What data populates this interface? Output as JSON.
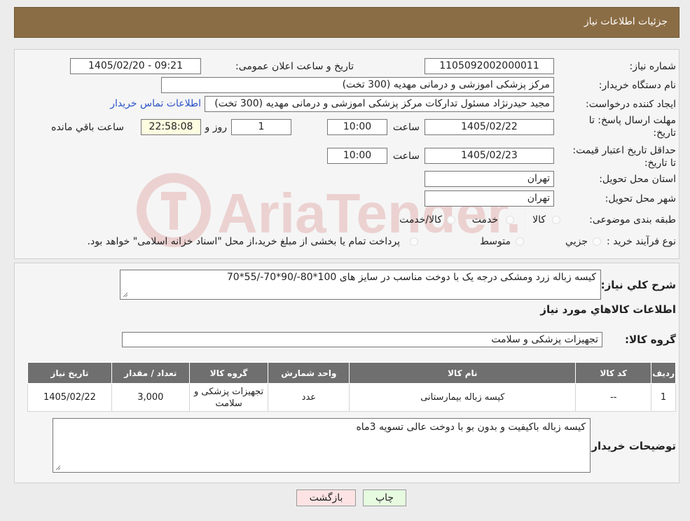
{
  "header": {
    "title": "جزئیات اطلاعات نیاز"
  },
  "info": {
    "need_number_label": "شماره نیاز:",
    "need_number": "1105092002000011",
    "announce_label": "تاریخ و ساعت اعلان عمومی:",
    "announce_value": "1405/02/20 - 09:21",
    "buyer_org_label": "نام دستگاه خریدار:",
    "buyer_org": "مرکز پزشکی  اموزشی و درمانی مهدیه (300 تخت)",
    "creator_label": "ایجاد کننده درخواست:",
    "creator": "مجید حیدرنژاد مسئول تدارکات مرکز پزشکی  اموزشی و درمانی مهدیه (300 تخت)",
    "contact_link": "اطلاعات تماس خریدار",
    "deadline_label": "مهلت ارسال پاسخ: تا تاریخ:",
    "deadline_date": "1405/02/22",
    "time_label": "ساعت",
    "deadline_time": "10:00",
    "days_value": "1",
    "days_label": "روز و",
    "remaining_time": "22:58:08",
    "remaining_label": "ساعت باقي مانده",
    "validity_label": "حداقل تاریخ اعتبار قیمت: تا تاریخ:",
    "validity_date": "1405/02/23",
    "validity_time": "10:00",
    "province_label": "استان محل تحویل:",
    "province": "تهران",
    "city_label": "شهر محل تحویل:",
    "city": "تهران",
    "category_label": "طبقه بندی موضوعی:",
    "category_options": [
      "کالا",
      "خدمت",
      "کالا/خدمت"
    ],
    "process_label": "نوع فرآیند خرید :",
    "process_options": [
      "جزیي",
      "متوسط"
    ],
    "process_note": "پرداخت تمام یا بخشی از مبلغ خرید،از محل \"اسناد خزانه اسلامی\" خواهد بود."
  },
  "summary": {
    "label": "شرح کلي نياز:",
    "text": "کیسه زباله زرد ومشکی درجه یک با دوخت مناسب در سایز های 100*80-/90*70-/55*70"
  },
  "goods": {
    "section_title": "اطلاعات کالاهاي مورد نياز",
    "group_label": "گروه کالا:",
    "group_value": "تجهیزات پزشکی و سلامت"
  },
  "table": {
    "headers": [
      "ردیف",
      "کد کالا",
      "نام کالا",
      "واحد شمارش",
      "گروه کالا",
      "تعداد / مقدار",
      "تاریخ نیاز"
    ],
    "rows": [
      [
        "1",
        "--",
        "کیسه زباله بیمارستانی",
        "عدد",
        "تجهیزات پزشکی و سلامت",
        "3,000",
        "1405/02/22"
      ]
    ]
  },
  "buyer_notes": {
    "label": "توضیحات خریدار:",
    "text": "کیسه زباله باکیفیت و بدون بو با دوخت عالی تسویه 3ماه"
  },
  "buttons": {
    "print": "چاپ",
    "back": "بازگشت"
  },
  "watermark": {
    "text": "AriaTender.neT"
  },
  "colors": {
    "header_bg": "#8b6d45",
    "link": "#2a54c8",
    "back_button_bg": "#fde3e3",
    "print_button_bg": "#e6fbe0"
  }
}
